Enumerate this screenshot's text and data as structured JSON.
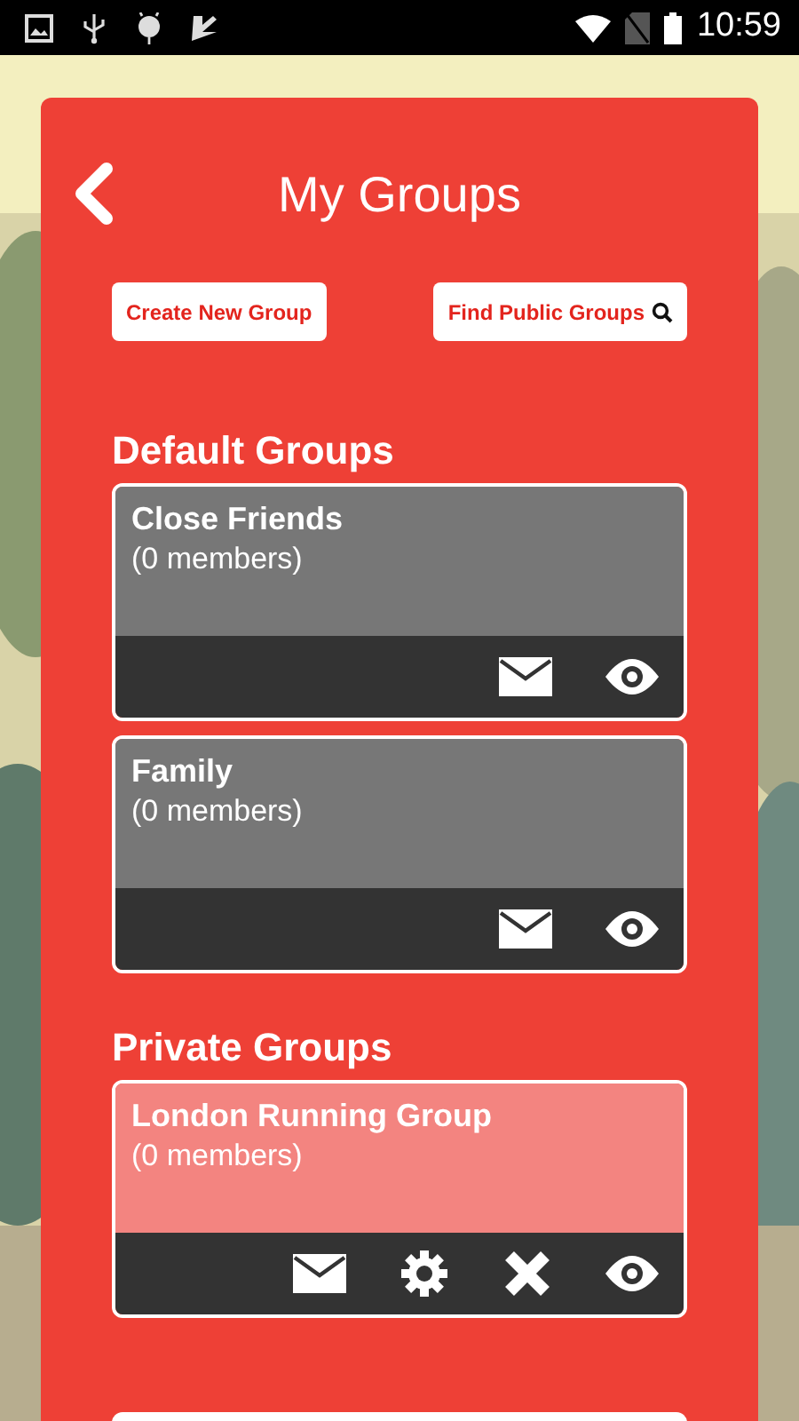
{
  "status_bar": {
    "time": "10:59"
  },
  "header": {
    "title": "My Groups"
  },
  "buttons": [
    {
      "label": "Create New Group",
      "kind": "plain"
    },
    {
      "label": "Find Public Groups",
      "kind": "search"
    }
  ],
  "sections": [
    {
      "heading": "Default Groups",
      "kind": "default",
      "groups": [
        {
          "name": "Close Friends",
          "members": "(0 members)",
          "actions": [
            {
              "kind": "mail"
            },
            {
              "kind": "view"
            }
          ]
        },
        {
          "name": "Family",
          "members": "(0 members)",
          "actions": [
            {
              "kind": "mail"
            },
            {
              "kind": "view"
            }
          ]
        }
      ]
    },
    {
      "heading": "Private Groups",
      "kind": "private",
      "groups": [
        {
          "name": "London Running Group",
          "members": "(0 members)",
          "actions": [
            {
              "kind": "mail"
            },
            {
              "kind": "settings"
            },
            {
              "kind": "delete"
            },
            {
              "kind": "view"
            }
          ]
        }
      ]
    }
  ]
}
